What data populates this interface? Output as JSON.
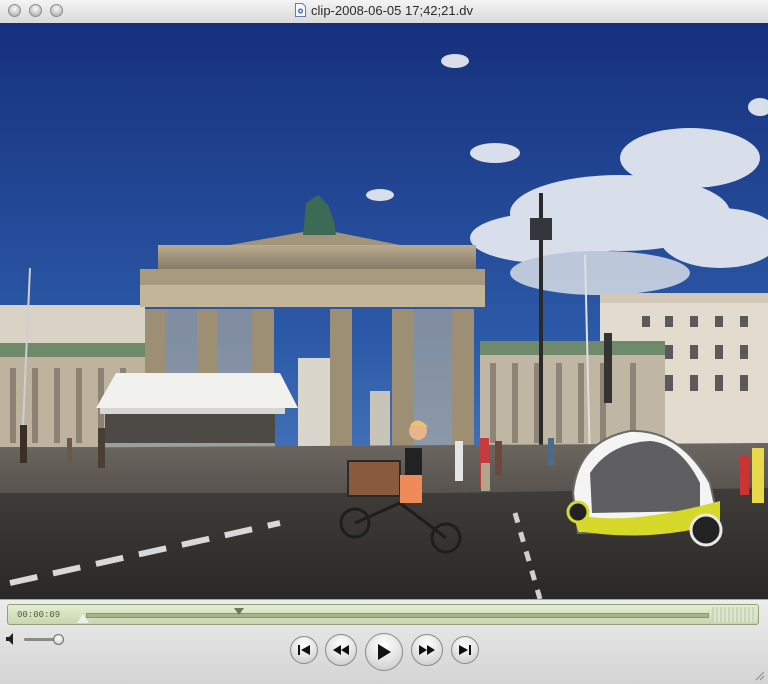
{
  "window": {
    "title": "clip-2008-06-05 17;42;21.dv",
    "title_icon": "dv-document-icon"
  },
  "traffic_lights": [
    "close",
    "minimize",
    "zoom"
  ],
  "video": {
    "description_icon": "video-frame"
  },
  "controls": {
    "timecode": "00:00:09",
    "progress_fraction": 0.245,
    "volume_fraction": 0.85,
    "buttons": [
      "skip-to-start",
      "rewind",
      "play",
      "fast-forward",
      "skip-to-end"
    ]
  },
  "colors": {
    "scrubber_bg": "#d6e0c2",
    "titlebar": "#e0e0e0",
    "sky": "#1c3a86"
  }
}
